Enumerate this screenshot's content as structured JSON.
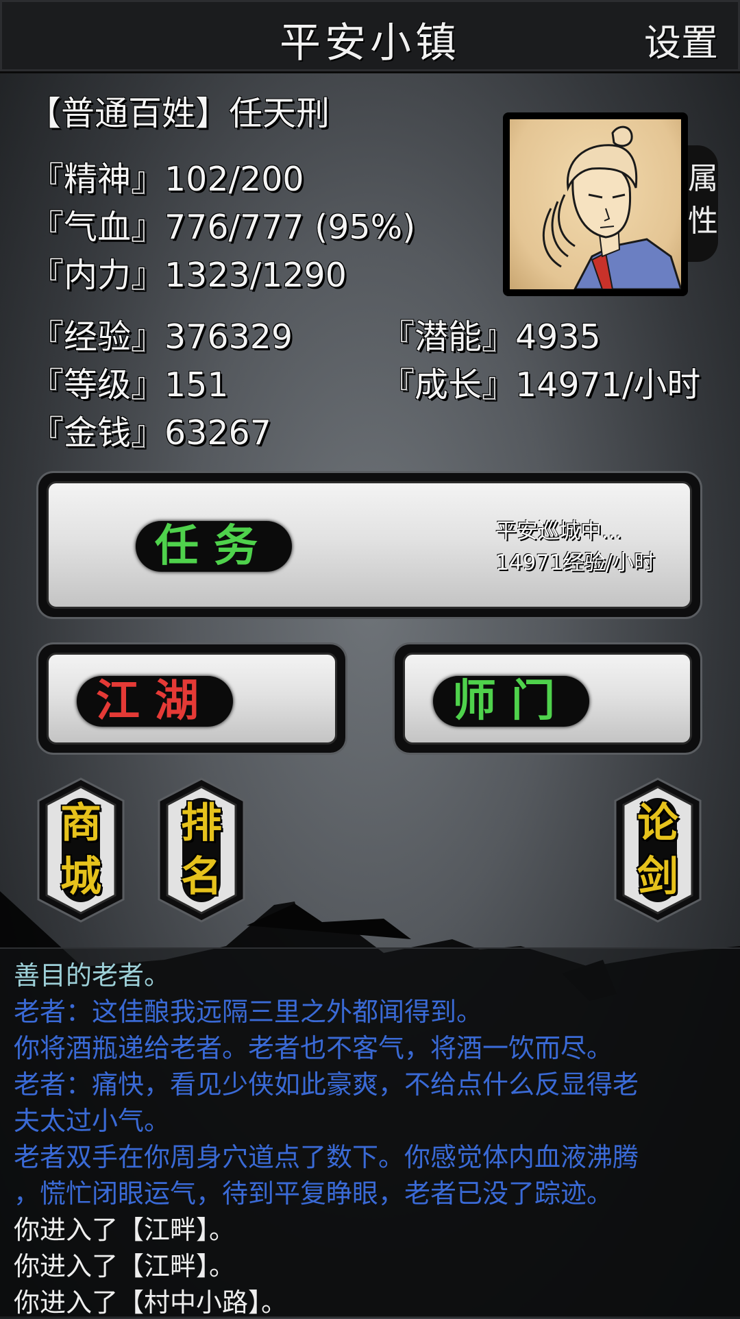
{
  "header": {
    "title": "平安小镇",
    "settings_label": "设置"
  },
  "player": {
    "rank_name": "【普通百姓】任天刑",
    "spirit": "『精神』102/200",
    "hp": "『气血』776/777 (95%)",
    "internal": "『内力』1323/1290",
    "exp": "『经验』376329",
    "potential": "『潜能』4935",
    "level": "『等级』151",
    "growth": "『成长』14971/小时",
    "money": "『金钱』63267",
    "attr_tab": "属性"
  },
  "buttons": {
    "task": "任务",
    "task_status": "平安巡城中...",
    "task_rate": "14971经验/小时",
    "jianghu": "江湖",
    "shimen": "师门",
    "shop": [
      "商",
      "城"
    ],
    "rank": [
      "排",
      "名"
    ],
    "duel": [
      "论",
      "剑"
    ]
  },
  "colors": {
    "task_green": "#4fd24c",
    "jianghu_red": "#e53a36",
    "hex_gold": "#e6c21c",
    "log_blue": "#3a6ad6"
  },
  "log": [
    "善目的老者。",
    "老者：这佳酿我远隔三里之外都闻得到。",
    "你将酒瓶递给老者。老者也不客气，将酒一饮而尽。",
    "老者：痛快，看见少侠如此豪爽，不给点什么反显得老",
    "夫太过小气。",
    "老者双手在你周身穴道点了数下。你感觉体内血液沸腾",
    "，慌忙闭眼运气，待到平复睁眼，老者已没了踪迹。",
    "你进入了【江畔】。",
    "你进入了【江畔】。",
    "你进入了【村中小路】。"
  ]
}
